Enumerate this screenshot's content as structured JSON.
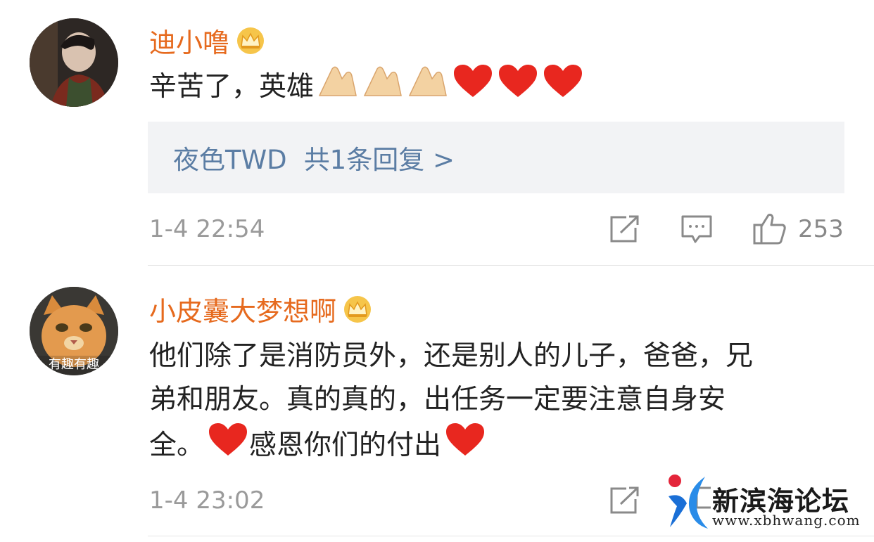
{
  "comments": [
    {
      "username": "迪小噜",
      "text": "辛苦了，英雄",
      "reply_author": "夜色TWD",
      "reply_count_label": "共1条回复 >",
      "timestamp": "1-4 22:54",
      "likes": "253"
    },
    {
      "username": "小皮囊大梦想啊",
      "avatar_caption": "有趣有趣",
      "text_line1": "他们除了是消防员外，还是别人的儿子，爸爸，兄",
      "text_line2": "弟和朋友。真的真的，出任务一定要注意自身安",
      "text_line3a": "全。",
      "text_line3b": "感恩你们的付出",
      "timestamp": "1-4 23:02"
    }
  ],
  "watermark": {
    "name": "新滨海论坛",
    "url": "www.xbhwang.com"
  },
  "colors": {
    "username": "#e66a1e",
    "reply_link": "#5b7da4",
    "meta": "#9a9a9a"
  }
}
